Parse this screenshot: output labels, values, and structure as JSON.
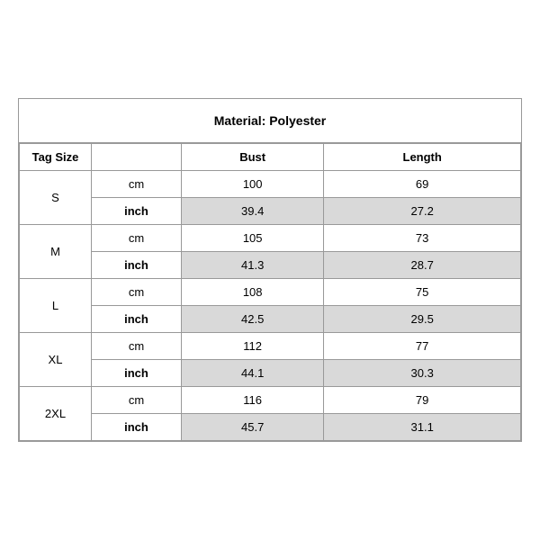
{
  "title": "Material: Polyester",
  "headers": {
    "tag_size": "Tag Size",
    "bust": "Bust",
    "length": "Length"
  },
  "rows": [
    {
      "size": "S",
      "cm": {
        "bust": "100",
        "length": "69"
      },
      "inch": {
        "bust": "39.4",
        "length": "27.2"
      }
    },
    {
      "size": "M",
      "cm": {
        "bust": "105",
        "length": "73"
      },
      "inch": {
        "bust": "41.3",
        "length": "28.7"
      }
    },
    {
      "size": "L",
      "cm": {
        "bust": "108",
        "length": "75"
      },
      "inch": {
        "bust": "42.5",
        "length": "29.5"
      }
    },
    {
      "size": "XL",
      "cm": {
        "bust": "112",
        "length": "77"
      },
      "inch": {
        "bust": "44.1",
        "length": "30.3"
      }
    },
    {
      "size": "2XL",
      "cm": {
        "bust": "116",
        "length": "79"
      },
      "inch": {
        "bust": "45.7",
        "length": "31.1"
      }
    }
  ],
  "units": {
    "cm": "cm",
    "inch": "inch"
  }
}
